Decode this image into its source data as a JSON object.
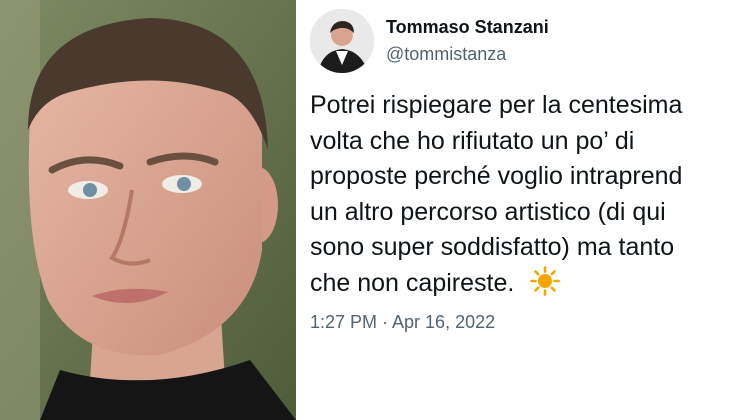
{
  "user": {
    "display_name": "Tommaso Stanzani",
    "handle": "@tommistanza"
  },
  "tweet": {
    "lines": [
      "Potrei rispiegare per la centesima",
      "volta che ho rifiutato un po’ di",
      "proposte perché voglio intraprend",
      "un altro percorso artistico (di qui",
      "sono super soddisfatto) ma tanto",
      "che non capireste."
    ],
    "emoji_icon": "sun-icon",
    "timestamp": "1:27 PM · Apr 16, 2022"
  },
  "colors": {
    "text": "#0f1419",
    "secondary": "#536471",
    "sun": "#f6a500"
  }
}
